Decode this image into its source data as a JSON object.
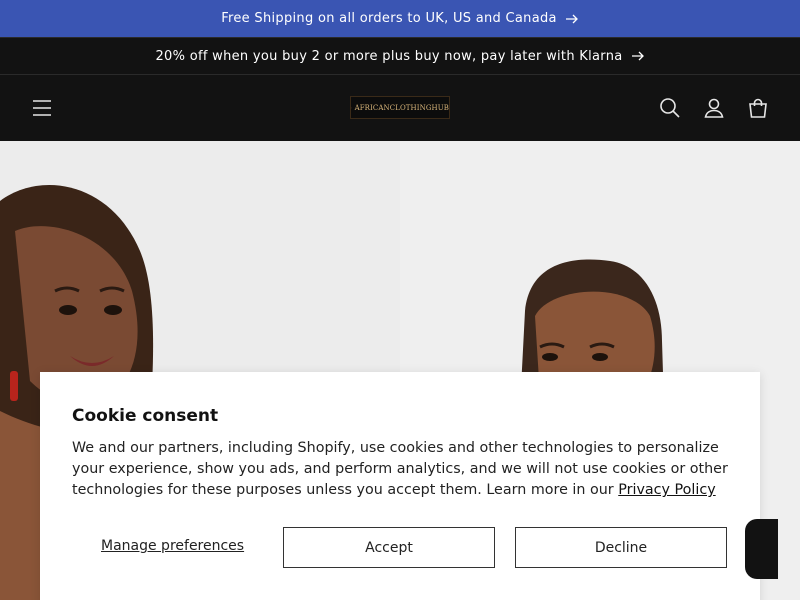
{
  "announcements": [
    {
      "text": "Free Shipping on all orders to UK, US and Canada",
      "icon": "arrow-right-icon"
    },
    {
      "text": "20% off when you buy 2 or more plus buy now, pay later with Klarna",
      "icon": "arrow-right-icon"
    }
  ],
  "header": {
    "logo_text": "AFRICANCLOTHINGHUB",
    "icons": [
      "menu-icon",
      "search-icon",
      "account-icon",
      "cart-icon"
    ]
  },
  "cookie": {
    "title": "Cookie consent",
    "body": "We and our partners, including Shopify, use cookies and other technologies to personalize your experience, show you ads, and perform analytics, and we will not use cookies or other technologies for these purposes unless you accept them. Learn more in our ",
    "privacy_link": "Privacy Policy",
    "manage": "Manage preferences",
    "accept": "Accept",
    "decline": "Decline"
  },
  "colors": {
    "announcement_blue": "#3a55b3",
    "header_dark": "#121212"
  }
}
